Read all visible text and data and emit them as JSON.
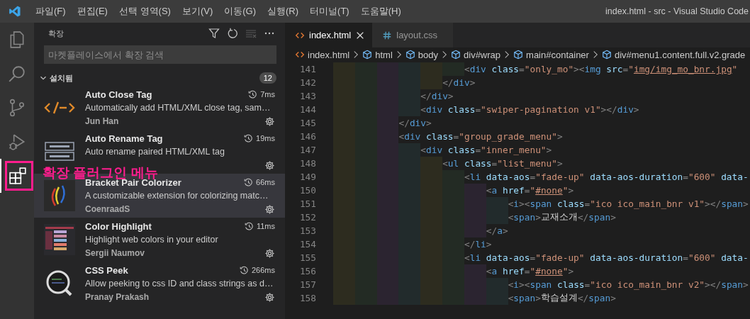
{
  "menu_bar": {
    "items": [
      "파일(F)",
      "편집(E)",
      "선택 영역(S)",
      "보기(V)",
      "이동(G)",
      "실행(R)",
      "터미널(T)",
      "도움말(H)"
    ]
  },
  "window_title": "index.html - src - Visual Studio Code",
  "activity_bar": [
    {
      "kind": "files",
      "selected": false
    },
    {
      "kind": "search",
      "selected": false
    },
    {
      "kind": "source-control",
      "selected": false
    },
    {
      "kind": "run-debug",
      "selected": false
    },
    {
      "kind": "extensions",
      "selected": true
    }
  ],
  "annotation": {
    "label": "확장 플러그인 메뉴"
  },
  "sidebar": {
    "title": "확장",
    "search": {
      "placeholder": "마켓플레이스에서 확장 검색"
    },
    "section": {
      "title": "설치됨",
      "expanded": true,
      "count": "12"
    },
    "extensions": [
      {
        "kind": "tag-text",
        "name": "Auto Close Tag",
        "description": "Automatically add HTML/XML close tag, sam…",
        "publisher": "Jun Han",
        "time": "7ms",
        "selected": false
      },
      {
        "kind": "tag-stack",
        "name": "Auto Rename Tag",
        "description": "Auto rename paired HTML/XML tag",
        "time": "19ms",
        "selected": false
      },
      {
        "kind": "brackets",
        "name": "Bracket Pair Colorizer",
        "description": "A customizable extension for colorizing matc…",
        "publisher": "CoenraadS",
        "time": "66ms",
        "selected": true
      },
      {
        "kind": "color-list",
        "name": "Color Highlight",
        "description": "Highlight web colors in your editor",
        "publisher": "Sergii Naumov",
        "time": "11ms",
        "selected": false
      },
      {
        "kind": "magnifier",
        "name": "CSS Peek",
        "description": "Allow peeking to css ID and class strings as d…",
        "publisher": "Pranay Prakash",
        "time": "266ms",
        "selected": false
      }
    ]
  },
  "tabs": [
    {
      "kind": "html",
      "label": "index.html",
      "selected": true
    },
    {
      "kind": "css",
      "label": "layout.css",
      "selected": false
    }
  ],
  "breadcrumbs": [
    {
      "kind": "file",
      "label": "index.html"
    },
    {
      "kind": "element",
      "label": "html"
    },
    {
      "kind": "element",
      "label": "body"
    },
    {
      "kind": "element",
      "label": "div#wrap"
    },
    {
      "kind": "element",
      "label": "main#container"
    },
    {
      "kind": "element",
      "label": "div#menu1.content.full.v2.grade"
    }
  ],
  "editor": {
    "lines": [
      {
        "number": "141",
        "tokens": [
          {
            "kind": "p",
            "text": "                        <"
          },
          {
            "kind": "tag",
            "text": "div"
          },
          {
            "kind": "attr",
            "text": " class"
          },
          {
            "kind": "p",
            "text": "="
          },
          {
            "kind": "str",
            "text": "\"only_mo\""
          },
          {
            "kind": "p",
            "text": "><"
          },
          {
            "kind": "tag",
            "text": "img"
          },
          {
            "kind": "attr",
            "text": " src"
          },
          {
            "kind": "p",
            "text": "="
          },
          {
            "kind": "str",
            "text": "\""
          },
          {
            "kind": "link",
            "text": "img/img_mo_bnr.jpg"
          },
          {
            "kind": "str",
            "text": "\""
          }
        ]
      },
      {
        "number": "142",
        "tokens": [
          {
            "kind": "p",
            "text": "                    </"
          },
          {
            "kind": "tag",
            "text": "div"
          },
          {
            "kind": "p",
            "text": ">"
          }
        ]
      },
      {
        "number": "143",
        "tokens": [
          {
            "kind": "p",
            "text": "                </"
          },
          {
            "kind": "tag",
            "text": "div"
          },
          {
            "kind": "p",
            "text": ">"
          }
        ]
      },
      {
        "number": "144",
        "tokens": [
          {
            "kind": "p",
            "text": "                <"
          },
          {
            "kind": "tag",
            "text": "div"
          },
          {
            "kind": "attr",
            "text": " class"
          },
          {
            "kind": "p",
            "text": "="
          },
          {
            "kind": "str",
            "text": "\"swiper-pagination v1\""
          },
          {
            "kind": "p",
            "text": "></"
          },
          {
            "kind": "tag",
            "text": "div"
          },
          {
            "kind": "p",
            "text": ">"
          }
        ]
      },
      {
        "number": "145",
        "tokens": [
          {
            "kind": "p",
            "text": "            </"
          },
          {
            "kind": "tag",
            "text": "div"
          },
          {
            "kind": "p",
            "text": ">"
          }
        ]
      },
      {
        "number": "146",
        "tokens": [
          {
            "kind": "p",
            "text": "            <"
          },
          {
            "kind": "tag",
            "text": "div"
          },
          {
            "kind": "attr",
            "text": " class"
          },
          {
            "kind": "p",
            "text": "="
          },
          {
            "kind": "str",
            "text": "\"group_grade_menu\""
          },
          {
            "kind": "p",
            "text": ">"
          }
        ]
      },
      {
        "number": "147",
        "tokens": [
          {
            "kind": "p",
            "text": "                <"
          },
          {
            "kind": "tag",
            "text": "div"
          },
          {
            "kind": "attr",
            "text": " class"
          },
          {
            "kind": "p",
            "text": "="
          },
          {
            "kind": "str",
            "text": "\"inner_menu\""
          },
          {
            "kind": "p",
            "text": ">"
          }
        ]
      },
      {
        "number": "148",
        "tokens": [
          {
            "kind": "p",
            "text": "                    <"
          },
          {
            "kind": "tag",
            "text": "ul"
          },
          {
            "kind": "attr",
            "text": " class"
          },
          {
            "kind": "p",
            "text": "="
          },
          {
            "kind": "str",
            "text": "\"list_menu\""
          },
          {
            "kind": "p",
            "text": ">"
          }
        ]
      },
      {
        "number": "149",
        "tokens": [
          {
            "kind": "p",
            "text": "                        <"
          },
          {
            "kind": "tag",
            "text": "li"
          },
          {
            "kind": "attr",
            "text": " data-aos"
          },
          {
            "kind": "p",
            "text": "="
          },
          {
            "kind": "str",
            "text": "\"fade-up\""
          },
          {
            "kind": "attr",
            "text": " data-aos-duration"
          },
          {
            "kind": "p",
            "text": "="
          },
          {
            "kind": "str",
            "text": "\"600\""
          },
          {
            "kind": "attr",
            "text": " data-"
          }
        ]
      },
      {
        "number": "150",
        "tokens": [
          {
            "kind": "p",
            "text": "                            <"
          },
          {
            "kind": "tag",
            "text": "a"
          },
          {
            "kind": "attr",
            "text": " href"
          },
          {
            "kind": "p",
            "text": "="
          },
          {
            "kind": "str",
            "text": "\""
          },
          {
            "kind": "link",
            "text": "#none"
          },
          {
            "kind": "str",
            "text": "\""
          },
          {
            "kind": "p",
            "text": ">"
          }
        ]
      },
      {
        "number": "151",
        "tokens": [
          {
            "kind": "p",
            "text": "                                <"
          },
          {
            "kind": "tag",
            "text": "i"
          },
          {
            "kind": "p",
            "text": "><"
          },
          {
            "kind": "tag",
            "text": "span"
          },
          {
            "kind": "attr",
            "text": " class"
          },
          {
            "kind": "p",
            "text": "="
          },
          {
            "kind": "str",
            "text": "\"ico ico_main_bnr v1\""
          },
          {
            "kind": "p",
            "text": "></"
          },
          {
            "kind": "tag",
            "text": "span"
          },
          {
            "kind": "p",
            "text": ">"
          }
        ]
      },
      {
        "number": "152",
        "tokens": [
          {
            "kind": "p",
            "text": "                                <"
          },
          {
            "kind": "tag",
            "text": "span"
          },
          {
            "kind": "p",
            "text": ">"
          },
          {
            "kind": "text",
            "text": "교재소개"
          },
          {
            "kind": "p",
            "text": "</"
          },
          {
            "kind": "tag",
            "text": "span"
          },
          {
            "kind": "p",
            "text": ">"
          }
        ]
      },
      {
        "number": "153",
        "tokens": [
          {
            "kind": "p",
            "text": "                            </"
          },
          {
            "kind": "tag",
            "text": "a"
          },
          {
            "kind": "p",
            "text": ">"
          }
        ]
      },
      {
        "number": "154",
        "tokens": [
          {
            "kind": "p",
            "text": "                        </"
          },
          {
            "kind": "tag",
            "text": "li"
          },
          {
            "kind": "p",
            "text": ">"
          }
        ]
      },
      {
        "number": "155",
        "tokens": [
          {
            "kind": "p",
            "text": "                        <"
          },
          {
            "kind": "tag",
            "text": "li"
          },
          {
            "kind": "attr",
            "text": " data-aos"
          },
          {
            "kind": "p",
            "text": "="
          },
          {
            "kind": "str",
            "text": "\"fade-up\""
          },
          {
            "kind": "attr",
            "text": " data-aos-duration"
          },
          {
            "kind": "p",
            "text": "="
          },
          {
            "kind": "str",
            "text": "\"600\""
          },
          {
            "kind": "attr",
            "text": " data-"
          }
        ]
      },
      {
        "number": "156",
        "tokens": [
          {
            "kind": "p",
            "text": "                            <"
          },
          {
            "kind": "tag",
            "text": "a"
          },
          {
            "kind": "attr",
            "text": " href"
          },
          {
            "kind": "p",
            "text": "="
          },
          {
            "kind": "str",
            "text": "\""
          },
          {
            "kind": "link",
            "text": "#none"
          },
          {
            "kind": "str",
            "text": "\""
          },
          {
            "kind": "p",
            "text": ">"
          }
        ]
      },
      {
        "number": "157",
        "tokens": [
          {
            "kind": "p",
            "text": "                                <"
          },
          {
            "kind": "tag",
            "text": "i"
          },
          {
            "kind": "p",
            "text": "><"
          },
          {
            "kind": "tag",
            "text": "span"
          },
          {
            "kind": "attr",
            "text": " class"
          },
          {
            "kind": "p",
            "text": "="
          },
          {
            "kind": "str",
            "text": "\"ico ico_main_bnr v2\""
          },
          {
            "kind": "p",
            "text": "></"
          },
          {
            "kind": "tag",
            "text": "span"
          },
          {
            "kind": "p",
            "text": ">"
          }
        ]
      },
      {
        "number": "158",
        "tokens": [
          {
            "kind": "p",
            "text": "                                <"
          },
          {
            "kind": "tag",
            "text": "span"
          },
          {
            "kind": "p",
            "text": ">"
          },
          {
            "kind": "text",
            "text": "학습설계"
          },
          {
            "kind": "p",
            "text": "</"
          },
          {
            "kind": "tag",
            "text": "span"
          },
          {
            "kind": "p",
            "text": ">"
          }
        ]
      }
    ]
  }
}
